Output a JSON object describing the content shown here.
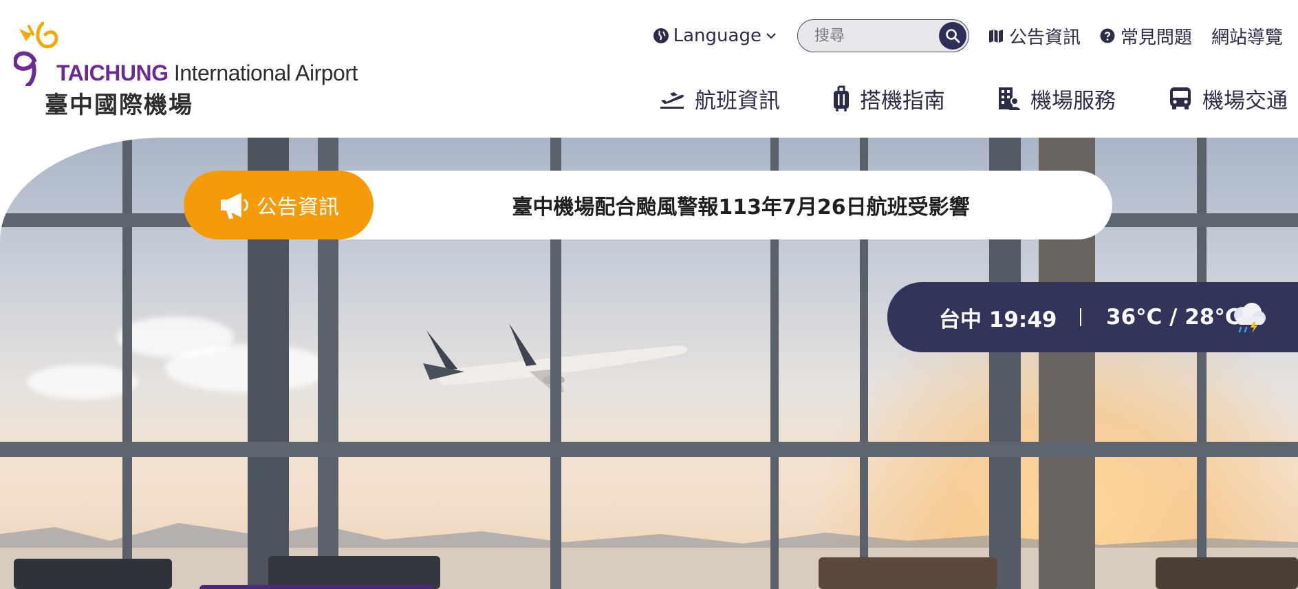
{
  "header": {
    "logo": {
      "brand": "TAICHUNG",
      "subtitle": "International Airport",
      "name_zh": "臺中國際機場",
      "icon": "airport-logo-icon"
    },
    "top_links": {
      "language_label": "Language",
      "search_placeholder": "搜尋",
      "announcements": "公告資訊",
      "faq": "常見問題",
      "sitemap": "網站導覽"
    },
    "nav": [
      {
        "label": "航班資訊",
        "icon": "plane-takeoff-icon"
      },
      {
        "label": "搭機指南",
        "icon": "luggage-icon"
      },
      {
        "label": "機場服務",
        "icon": "building-service-icon"
      },
      {
        "label": "機場交通",
        "icon": "bus-icon"
      }
    ]
  },
  "hero": {
    "announcement": {
      "tag": "公告資訊",
      "text": "臺中機場配合颱風警報113年7月26日航班受影響"
    },
    "weather": {
      "location_time": "台中 19:49",
      "temperature": "36°C / 28°C",
      "icon": "thunderstorm-rain-icon"
    }
  },
  "colors": {
    "brand_purple": "#6a2c91",
    "nav_text": "#2c2c48",
    "announcement_orange": "#f59a08",
    "weather_bg": "#33345a"
  }
}
